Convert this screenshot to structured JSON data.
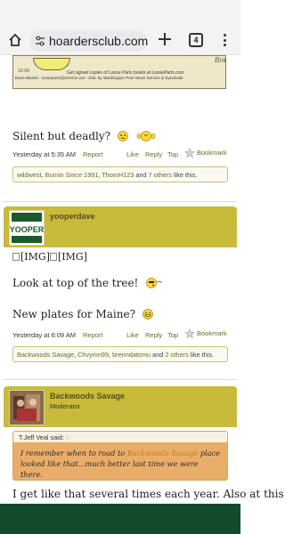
{
  "browser": {
    "url": "hoardersclub.com",
    "tab_count": "4",
    "icons": [
      "home-icon",
      "site-settings-icon",
      "new-tab-icon",
      "tabs-icon",
      "menu-icon"
    ]
  },
  "comic": {
    "number": "12-09",
    "brand": "Brazen",
    "caption_line1": "Get signed copies of Loose Parts books at LooseParts.com",
    "caption_line2": "Dave Blazek - looseparts@verizon.net - Dist. by Washington Post News Service & Syndicate"
  },
  "post1": {
    "text": "Silent but deadly?",
    "time": "Yesterday at 5:35 AM",
    "report": "Report",
    "like": "Like",
    "reply": "Reply",
    "top": "Top",
    "bookmark": "Bookmark",
    "likes": {
      "users": [
        "wildwest",
        "Burnin Since 1991",
        "ThomH123"
      ],
      "others": "7 others",
      "suffix": "like this.",
      "sep": ",",
      "and": "and"
    }
  },
  "post2": {
    "username": "yooperdave",
    "avatar_text": "YOOPER",
    "img_placeholder": "[IMG]",
    "line1": "Look at top of the tree!",
    "line2": "New plates for Maine?",
    "time": "Yesterday at 6:09 AM",
    "report": "Report",
    "like": "Like",
    "reply": "Reply",
    "top": "Top",
    "bookmark": "Bookmark",
    "likes": {
      "users": [
        "Backwoods Savage",
        "Chvymn99",
        "brenndatomu"
      ],
      "others": "2 others",
      "suffix": "like this.",
      "and": "and"
    }
  },
  "post3": {
    "username": "Backwoods Savage",
    "role": "Moderator",
    "quote_author": "T.Jeff Veal said:",
    "quote_pre": "I remember when to road to",
    "quote_link": "Backwoods Savage",
    "quote_post": "place looked like that...much better last time we were there.",
    "text": "I get like that several times each year. Also at this"
  },
  "colors": {
    "header_band": "#c8bb3c",
    "link": "#6b6b2a",
    "quote_bg": "#e9ad6a",
    "bottom_bar": "#124c2a"
  }
}
